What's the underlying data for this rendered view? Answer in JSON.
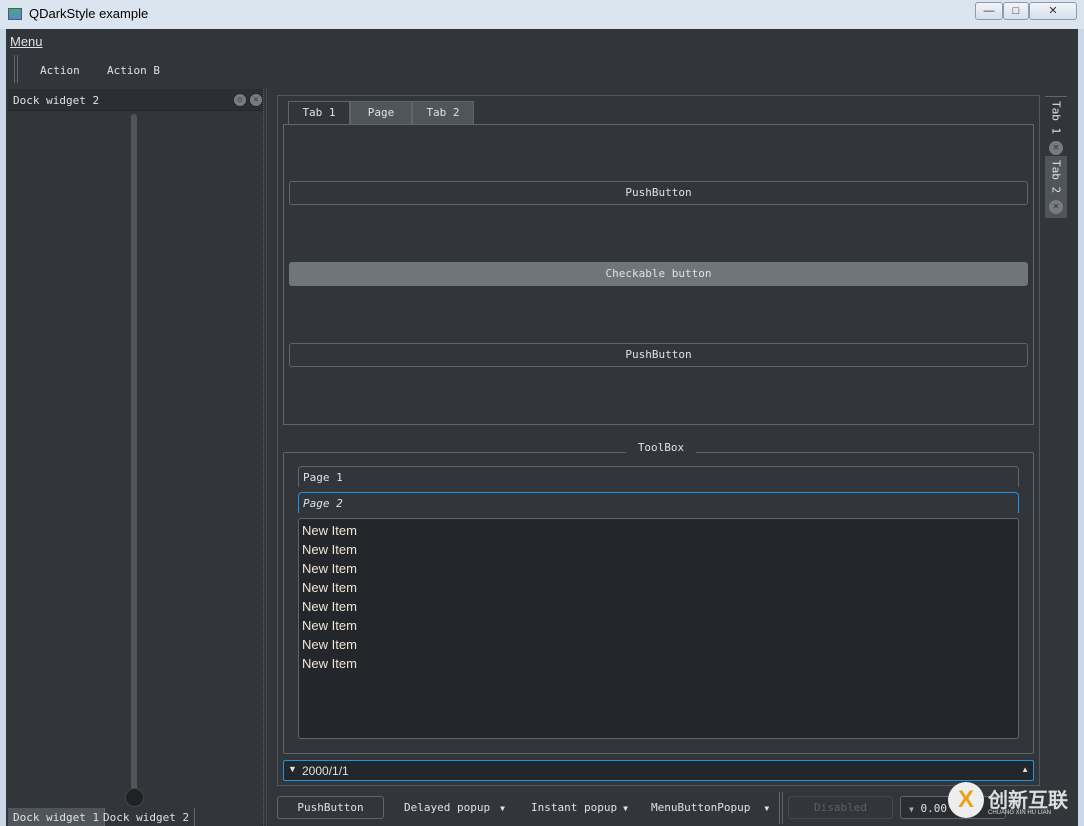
{
  "window": {
    "title": "QDarkStyle example",
    "minimize": "—",
    "maximize": "□",
    "close": "✕"
  },
  "menubar": {
    "menu": "Menu"
  },
  "toolbar": {
    "action": "Action",
    "action_b": "Action B"
  },
  "dock": {
    "title": "Dock widget 2",
    "tabs": [
      "Dock widget 1",
      "Dock widget 2"
    ],
    "slider_value": 0
  },
  "tabs": {
    "items": [
      "Tab 1",
      "Page",
      "Tab 2"
    ],
    "selected": 0
  },
  "tab_page": {
    "push1": "PushButton",
    "checkable": "Checkable button",
    "push2": "PushButton"
  },
  "toolbox": {
    "title": "ToolBox",
    "pages": [
      "Page 1",
      "Page 2"
    ],
    "items": [
      "New Item",
      "New Item",
      "New Item",
      "New Item",
      "New Item",
      "New Item",
      "New Item",
      "New Item"
    ]
  },
  "date_edit": {
    "value": "2000/1/1"
  },
  "vertical_tabs": [
    "Tab 1",
    "Tab 2"
  ],
  "bottom": {
    "push": "PushButton",
    "delayed": "Delayed popup",
    "instant": "Instant popup",
    "menu_popup": "MenuButtonPopup",
    "disabled": "Disabled",
    "spin_value": "0.00"
  },
  "watermark": {
    "text": "创新互联",
    "sub": "CHUANG XIN HU LIAN"
  },
  "colors": {
    "accent": "#1a94e4",
    "background": "#32363b",
    "list_bg": "#23262a"
  }
}
